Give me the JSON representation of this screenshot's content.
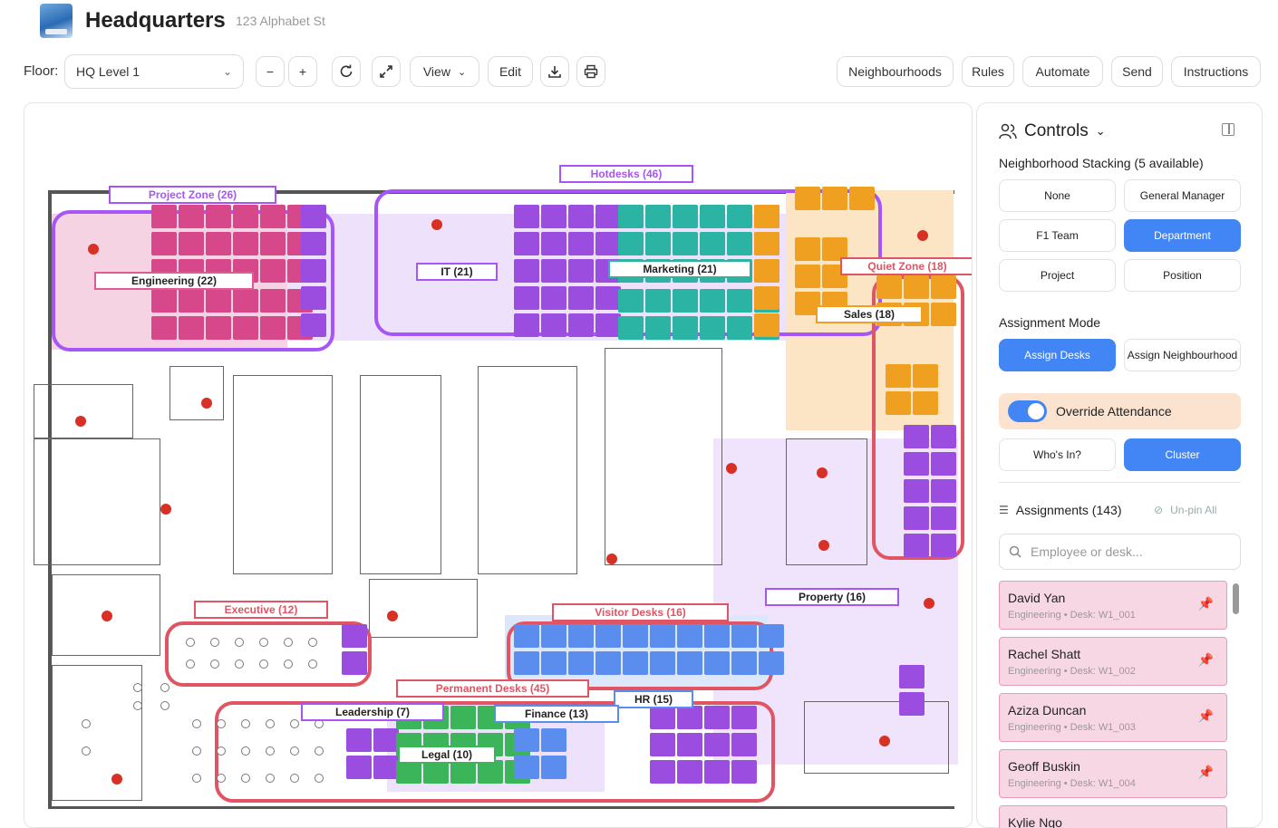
{
  "header": {
    "title": "Headquarters",
    "address": "123 Alphabet St"
  },
  "toolbar": {
    "floor_label": "Floor:",
    "floor_value": "HQ Level 1",
    "zoom_out": "−",
    "zoom_in": "+",
    "view_label": "View",
    "edit_label": "Edit",
    "right_buttons": [
      "Neighbourhoods",
      "Rules",
      "Automate",
      "Send",
      "Instructions"
    ]
  },
  "map": {
    "zones": [
      {
        "label": "Project Zone (26)",
        "color": "#a855f7"
      },
      {
        "label": "Hotdesks (46)",
        "color": "#a855f7"
      },
      {
        "label": "Engineering (22)",
        "color": "#e05a94"
      },
      {
        "label": "IT (21)",
        "color": "#a855f7"
      },
      {
        "label": "Marketing (21)",
        "color": "#2bb3a3"
      },
      {
        "label": "Quiet Zone (18)",
        "color": "#e05563"
      },
      {
        "label": "Sales (18)",
        "color": "#f0a020"
      },
      {
        "label": "Property (16)",
        "color": "#a855f7"
      },
      {
        "label": "Executive (12)",
        "color": "#e05563"
      },
      {
        "label": "Visitor Desks (16)",
        "color": "#e05563"
      },
      {
        "label": "Permanent Desks (45)",
        "color": "#e05563"
      },
      {
        "label": "HR (15)",
        "color": "#5b8def"
      },
      {
        "label": "Leadership (7)",
        "color": "#a855f7"
      },
      {
        "label": "Finance (13)",
        "color": "#5b8def"
      },
      {
        "label": "Legal (10)",
        "color": "#3cb45a"
      }
    ]
  },
  "controls": {
    "title": "Controls",
    "stacking_title": "Neighborhood Stacking (5 available)",
    "stacking_options": [
      "None",
      "General Manager",
      "F1 Team",
      "Department",
      "Project",
      "Position"
    ],
    "stacking_active": "Department",
    "assignment_mode_title": "Assignment Mode",
    "assign_desks": "Assign Desks",
    "assign_neighbourhood": "Assign Neighbourhood",
    "override_label": "Override Attendance",
    "whos_in": "Who's In?",
    "cluster": "Cluster",
    "assignments_title": "Assignments (143)",
    "unpin_all": "Un-pin All",
    "search_placeholder": "Employee or desk...",
    "assignments": [
      {
        "name": "David Yan",
        "detail": "Engineering • Desk: W1_001"
      },
      {
        "name": "Rachel Shatt",
        "detail": "Engineering • Desk: W1_002"
      },
      {
        "name": "Aziza Duncan",
        "detail": "Engineering • Desk: W1_003"
      },
      {
        "name": "Geoff Buskin",
        "detail": "Engineering • Desk: W1_004"
      },
      {
        "name": "Kylie Ngo",
        "detail": ""
      }
    ]
  },
  "colors": {
    "accent": "#4285f4",
    "override_bg": "#fbe3cf",
    "assignment_card": "#f8d7e4"
  }
}
